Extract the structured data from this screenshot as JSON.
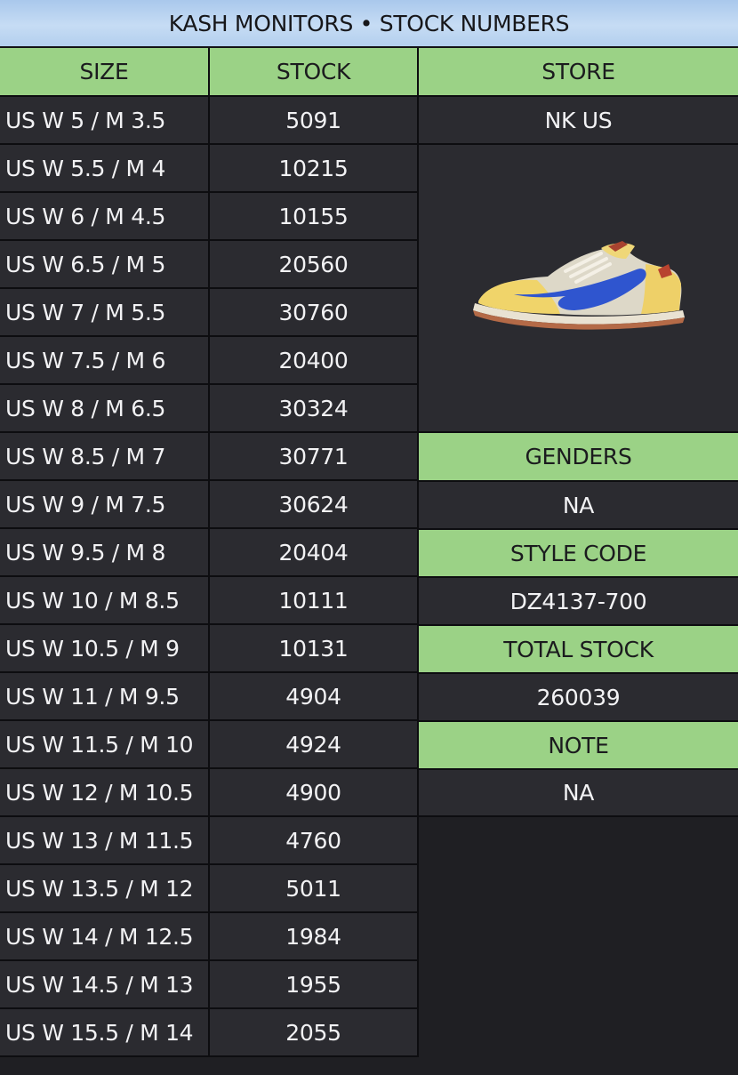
{
  "title": "KASH MONITORS • STOCK NUMBERS",
  "headers": {
    "size": "SIZE",
    "stock": "STOCK",
    "store": "STORE"
  },
  "rows": [
    {
      "size": "US W 5 / M 3.5",
      "stock": "5091"
    },
    {
      "size": "US W 5.5 / M 4",
      "stock": "10215"
    },
    {
      "size": "US W 6 / M 4.5",
      "stock": "10155"
    },
    {
      "size": "US W 6.5 / M 5",
      "stock": "20560"
    },
    {
      "size": "US W 7 / M 5.5",
      "stock": "30760"
    },
    {
      "size": "US W 7.5 / M 6",
      "stock": "20400"
    },
    {
      "size": "US W 8 / M 6.5",
      "stock": "30324"
    },
    {
      "size": "US W 8.5 / M 7",
      "stock": "30771"
    },
    {
      "size": "US W 9 / M 7.5",
      "stock": "30624"
    },
    {
      "size": "US W 9.5 / M 8",
      "stock": "20404"
    },
    {
      "size": "US W 10 / M 8.5",
      "stock": "10111"
    },
    {
      "size": "US W 10.5 / M 9",
      "stock": "10131"
    },
    {
      "size": "US W 11 / M 9.5",
      "stock": "4904"
    },
    {
      "size": "US W 11.5 / M 10",
      "stock": "4924"
    },
    {
      "size": "US W 12 / M 10.5",
      "stock": "4900"
    },
    {
      "size": "US W 13 / M 11.5",
      "stock": "4760"
    },
    {
      "size": "US W 13.5 / M 12",
      "stock": "5011"
    },
    {
      "size": "US W 14 / M 12.5",
      "stock": "1984"
    },
    {
      "size": "US W 14.5 / M 13",
      "stock": "1955"
    },
    {
      "size": "US W 15.5 / M 14",
      "stock": "2055"
    }
  ],
  "side": {
    "store_value": "NK US",
    "product_image_icon": "sneaker-icon",
    "genders_label": "GENDERS",
    "genders_value": "NA",
    "style_code_label": "STYLE CODE",
    "style_code_value": "DZ4137-700",
    "total_stock_label": "TOTAL STOCK",
    "total_stock_value": "260039",
    "note_label": "NOTE",
    "note_value": "NA"
  },
  "colors": {
    "header_green": "#9bd286",
    "title_blue": "#b3cfee",
    "cell_dark": "#2b2b30",
    "background": "#1f1f23"
  }
}
